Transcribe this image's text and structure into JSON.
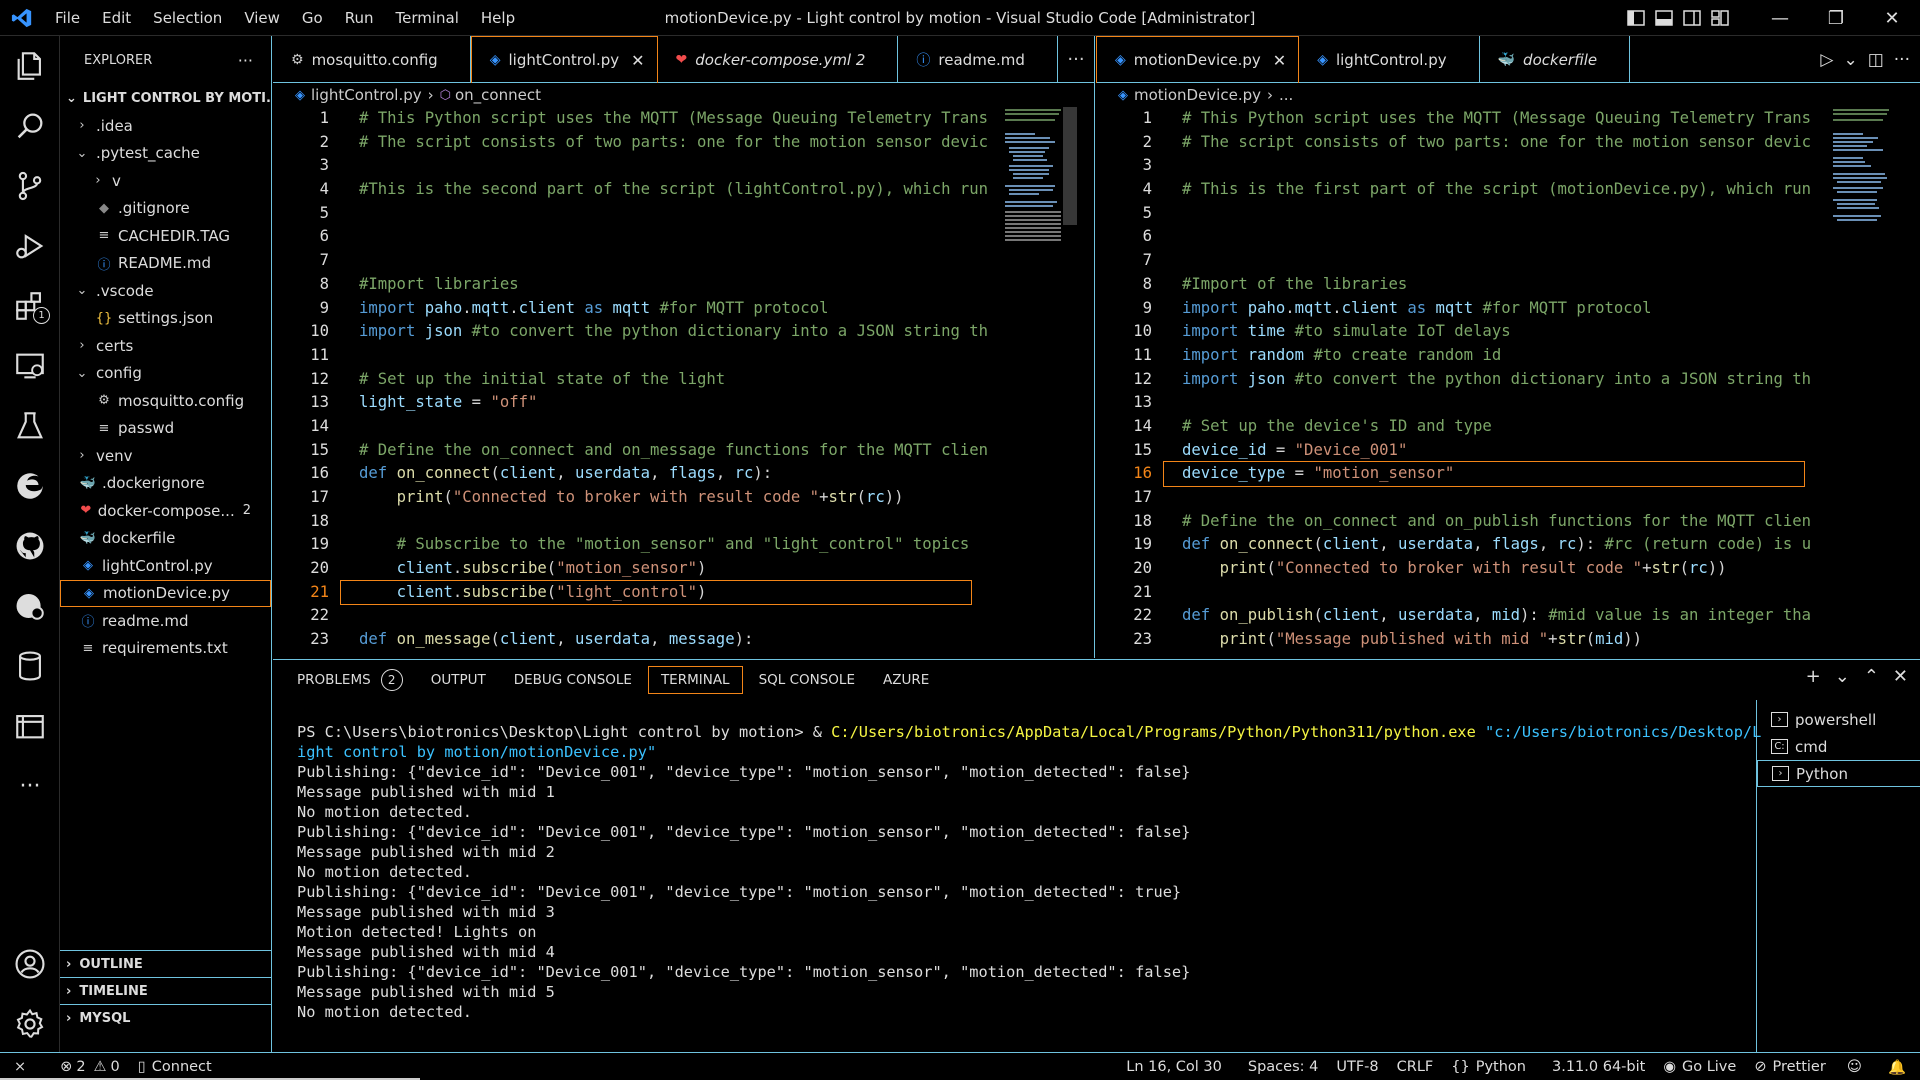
{
  "titlebar": {
    "menu": [
      "File",
      "Edit",
      "Selection",
      "View",
      "Go",
      "Run",
      "Terminal",
      "Help"
    ],
    "title": "motionDevice.py - Light control by motion - Visual Studio Code [Administrator]"
  },
  "sidebar": {
    "header": "EXPLORER",
    "folder": "LIGHT CONTROL BY MOTI...",
    "items": [
      {
        "label": ".idea",
        "chev": "›",
        "icon": "",
        "indent": 1
      },
      {
        "label": ".pytest_cache",
        "chev": "⌄",
        "icon": "",
        "indent": 1
      },
      {
        "label": "v",
        "chev": "›",
        "icon": "",
        "indent": 2
      },
      {
        "label": ".gitignore",
        "chev": "",
        "icon": "◆",
        "indent": 2
      },
      {
        "label": "CACHEDIR.TAG",
        "chev": "",
        "icon": "≡",
        "indent": 2
      },
      {
        "label": "README.md",
        "chev": "",
        "icon": "ⓘ",
        "indent": 2
      },
      {
        "label": ".vscode",
        "chev": "⌄",
        "icon": "",
        "indent": 1
      },
      {
        "label": "settings.json",
        "chev": "",
        "icon": "{}",
        "indent": 2
      },
      {
        "label": "certs",
        "chev": "›",
        "icon": "",
        "indent": 1
      },
      {
        "label": "config",
        "chev": "⌄",
        "icon": "",
        "indent": 1
      },
      {
        "label": "mosquitto.config",
        "chev": "",
        "icon": "⚙",
        "indent": 2
      },
      {
        "label": "passwd",
        "chev": "",
        "icon": "≡",
        "indent": 2
      },
      {
        "label": "venv",
        "chev": "›",
        "icon": "",
        "indent": 1
      },
      {
        "label": ".dockerignore",
        "chev": "",
        "icon": "🐳",
        "indent": 1
      },
      {
        "label": "docker-compose...",
        "chev": "",
        "icon": "❤",
        "indent": 1,
        "badge": "2"
      },
      {
        "label": "dockerfile",
        "chev": "",
        "icon": "🐳",
        "indent": 1
      },
      {
        "label": "lightControl.py",
        "chev": "",
        "icon": "◈",
        "indent": 1
      },
      {
        "label": "motionDevice.py",
        "chev": "",
        "icon": "◈",
        "indent": 1,
        "selected": true
      },
      {
        "label": "readme.md",
        "chev": "",
        "icon": "ⓘ",
        "indent": 1
      },
      {
        "label": "requirements.txt",
        "chev": "",
        "icon": "≡",
        "indent": 1
      }
    ],
    "sections": [
      "OUTLINE",
      "TIMELINE",
      "MYSQL"
    ],
    "more": "···"
  },
  "editor_left": {
    "tabs": [
      {
        "label": "mosquitto.config",
        "icon": "⚙",
        "italic": false
      },
      {
        "label": "lightControl.py",
        "icon": "◈",
        "italic": false,
        "active": true,
        "close": "✕"
      },
      {
        "label": "docker-compose.yml 2",
        "icon": "❤",
        "italic": true
      },
      {
        "label": "readme.md",
        "icon": "ⓘ",
        "italic": false
      }
    ],
    "more": "···",
    "breadcrumb": [
      "lightControl.py",
      "on_connect"
    ],
    "current_line": 21,
    "lines": [
      [
        [
          "c-com",
          "# This Python script uses the MQTT (Message Queuing Telemetry Trans"
        ]
      ],
      [
        [
          "c-com",
          "# The script consists of two parts: one for the motion sensor devic"
        ]
      ],
      [],
      [
        [
          "c-com",
          "#This is the second part of the script (lightControl.py), which run"
        ]
      ],
      [],
      [],
      [],
      [
        [
          "c-com",
          "#Import libraries"
        ]
      ],
      [
        [
          "c-kw",
          "import "
        ],
        [
          "c-var",
          "paho"
        ],
        [
          "c-txt",
          "."
        ],
        [
          "c-var",
          "mqtt"
        ],
        [
          "c-txt",
          "."
        ],
        [
          "c-var",
          "client"
        ],
        [
          "c-kw",
          " as "
        ],
        [
          "c-var",
          "mqtt"
        ],
        [
          "c-com",
          " #for MQTT protocol"
        ]
      ],
      [
        [
          "c-kw",
          "import "
        ],
        [
          "c-var",
          "json"
        ],
        [
          "c-com",
          " #to convert the python dictionary into a JSON string th"
        ]
      ],
      [],
      [
        [
          "c-com",
          "# Set up the initial state of the light"
        ]
      ],
      [
        [
          "c-var",
          "light_state"
        ],
        [
          "c-txt",
          " = "
        ],
        [
          "c-str",
          "\"off\""
        ]
      ],
      [],
      [
        [
          "c-com",
          "# Define the on_connect and on_message functions for the MQTT clien"
        ]
      ],
      [
        [
          "c-kw",
          "def "
        ],
        [
          "c-fn",
          "on_connect"
        ],
        [
          "c-txt",
          "("
        ],
        [
          "c-var",
          "client"
        ],
        [
          "c-txt",
          ", "
        ],
        [
          "c-var",
          "userdata"
        ],
        [
          "c-txt",
          ", "
        ],
        [
          "c-var",
          "flags"
        ],
        [
          "c-txt",
          ", "
        ],
        [
          "c-var",
          "rc"
        ],
        [
          "c-txt",
          "):"
        ]
      ],
      [
        [
          "c-txt",
          "    "
        ],
        [
          "c-fn",
          "print"
        ],
        [
          "c-txt",
          "("
        ],
        [
          "c-str",
          "\"Connected to broker with result code \""
        ],
        [
          "c-txt",
          "+"
        ],
        [
          "c-fn",
          "str"
        ],
        [
          "c-txt",
          "("
        ],
        [
          "c-var",
          "rc"
        ],
        [
          "c-txt",
          "))"
        ]
      ],
      [],
      [
        [
          "c-txt",
          "    "
        ],
        [
          "c-com",
          "# Subscribe to the \"motion_sensor\" and \"light_control\" topics"
        ]
      ],
      [
        [
          "c-txt",
          "    "
        ],
        [
          "c-var",
          "client"
        ],
        [
          "c-txt",
          "."
        ],
        [
          "c-fn",
          "subscribe"
        ],
        [
          "c-txt",
          "("
        ],
        [
          "c-str",
          "\"motion_sensor\""
        ],
        [
          "c-txt",
          ")"
        ]
      ],
      [
        [
          "c-txt",
          "    "
        ],
        [
          "c-var",
          "client"
        ],
        [
          "c-txt",
          "."
        ],
        [
          "c-fn",
          "subscribe"
        ],
        [
          "c-txt",
          "("
        ],
        [
          "c-str",
          "\"light_control\""
        ],
        [
          "c-txt",
          ")"
        ]
      ],
      [],
      [
        [
          "c-kw",
          "def "
        ],
        [
          "c-fn",
          "on_message"
        ],
        [
          "c-txt",
          "("
        ],
        [
          "c-var",
          "client"
        ],
        [
          "c-txt",
          ", "
        ],
        [
          "c-var",
          "userdata"
        ],
        [
          "c-txt",
          ", "
        ],
        [
          "c-var",
          "message"
        ],
        [
          "c-txt",
          "):"
        ]
      ]
    ]
  },
  "editor_right": {
    "tabs": [
      {
        "label": "motionDevice.py",
        "icon": "◈",
        "italic": false,
        "active": true,
        "close": "✕"
      },
      {
        "label": "lightControl.py",
        "icon": "◈",
        "italic": false
      },
      {
        "label": "dockerfile",
        "icon": "🐳",
        "italic": true
      }
    ],
    "actions": [
      "▷",
      "⌄",
      "◫",
      "···"
    ],
    "breadcrumb": [
      "motionDevice.py",
      "..."
    ],
    "current_line": 16,
    "lines": [
      [
        [
          "c-com",
          "# This Python script uses the MQTT (Message Queuing Telemetry Trans"
        ]
      ],
      [
        [
          "c-com",
          "# The script consists of two parts: one for the motion sensor devic"
        ]
      ],
      [],
      [
        [
          "c-com",
          "# This is the first part of the script (motionDevice.py), which run"
        ]
      ],
      [],
      [],
      [],
      [
        [
          "c-com",
          "#Import of the libraries"
        ]
      ],
      [
        [
          "c-kw",
          "import "
        ],
        [
          "c-var",
          "paho"
        ],
        [
          "c-txt",
          "."
        ],
        [
          "c-var",
          "mqtt"
        ],
        [
          "c-txt",
          "."
        ],
        [
          "c-var",
          "client"
        ],
        [
          "c-kw",
          " as "
        ],
        [
          "c-var",
          "mqtt"
        ],
        [
          "c-com",
          " #for MQTT protocol"
        ]
      ],
      [
        [
          "c-kw",
          "import "
        ],
        [
          "c-var",
          "time"
        ],
        [
          "c-com",
          " #to simulate IoT delays"
        ]
      ],
      [
        [
          "c-kw",
          "import "
        ],
        [
          "c-var",
          "random"
        ],
        [
          "c-com",
          " #to create random id"
        ]
      ],
      [
        [
          "c-kw",
          "import "
        ],
        [
          "c-var",
          "json"
        ],
        [
          "c-com",
          " #to convert the python dictionary into a JSON string th"
        ]
      ],
      [],
      [
        [
          "c-com",
          "# Set up the device's ID and type"
        ]
      ],
      [
        [
          "c-var",
          "device_id"
        ],
        [
          "c-txt",
          " = "
        ],
        [
          "c-str",
          "\"Device_001\""
        ]
      ],
      [
        [
          "c-var",
          "device_type"
        ],
        [
          "c-txt",
          " = "
        ],
        [
          "c-str",
          "\"motion_sensor\""
        ]
      ],
      [],
      [
        [
          "c-com",
          "# Define the on_connect and on_publish functions for the MQTT clien"
        ]
      ],
      [
        [
          "c-kw",
          "def "
        ],
        [
          "c-fn",
          "on_connect"
        ],
        [
          "c-txt",
          "("
        ],
        [
          "c-var",
          "client"
        ],
        [
          "c-txt",
          ", "
        ],
        [
          "c-var",
          "userdata"
        ],
        [
          "c-txt",
          ", "
        ],
        [
          "c-var",
          "flags"
        ],
        [
          "c-txt",
          ", "
        ],
        [
          "c-var",
          "rc"
        ],
        [
          "c-txt",
          "): "
        ],
        [
          "c-com",
          "#rc (return code) is u"
        ]
      ],
      [
        [
          "c-txt",
          "    "
        ],
        [
          "c-fn",
          "print"
        ],
        [
          "c-txt",
          "("
        ],
        [
          "c-str",
          "\"Connected to broker with result code \""
        ],
        [
          "c-txt",
          "+"
        ],
        [
          "c-fn",
          "str"
        ],
        [
          "c-txt",
          "("
        ],
        [
          "c-var",
          "rc"
        ],
        [
          "c-txt",
          "))"
        ]
      ],
      [],
      [
        [
          "c-kw",
          "def "
        ],
        [
          "c-fn",
          "on_publish"
        ],
        [
          "c-txt",
          "("
        ],
        [
          "c-var",
          "client"
        ],
        [
          "c-txt",
          ", "
        ],
        [
          "c-var",
          "userdata"
        ],
        [
          "c-txt",
          ", "
        ],
        [
          "c-var",
          "mid"
        ],
        [
          "c-txt",
          "): "
        ],
        [
          "c-com",
          "#mid value is an integer tha"
        ]
      ],
      [
        [
          "c-txt",
          "    "
        ],
        [
          "c-fn",
          "print"
        ],
        [
          "c-txt",
          "("
        ],
        [
          "c-str",
          "\"Message published with mid \""
        ],
        [
          "c-txt",
          "+"
        ],
        [
          "c-fn",
          "str"
        ],
        [
          "c-txt",
          "("
        ],
        [
          "c-var",
          "mid"
        ],
        [
          "c-txt",
          "))"
        ]
      ]
    ]
  },
  "panel": {
    "tabs": [
      {
        "label": "PROBLEMS",
        "badge": "2"
      },
      {
        "label": "OUTPUT"
      },
      {
        "label": "DEBUG CONSOLE"
      },
      {
        "label": "TERMINAL",
        "active": true
      },
      {
        "label": "SQL CONSOLE"
      },
      {
        "label": "AZURE"
      }
    ],
    "actions": [
      "+",
      "⌄",
      "⌃",
      "✕"
    ],
    "terminal": {
      "prompt": "PS C:\\Users\\biotronics\\Desktop\\Light control by motion> & ",
      "exe": "C:/Users/biotronics/AppData/Local/Programs/Python/Python311/python.exe",
      "arg1": " \"c:/Users/biotronics/Desktop/L",
      "arg2": "ight control by motion/motionDevice.py\"",
      "output": [
        "Publishing: {\"device_id\": \"Device_001\", \"device_type\": \"motion_sensor\", \"motion_detected\": false}",
        "Message published with mid 1",
        "No motion detected.",
        "Publishing: {\"device_id\": \"Device_001\", \"device_type\": \"motion_sensor\", \"motion_detected\": false}",
        "Message published with mid 2",
        "No motion detected.",
        "Publishing: {\"device_id\": \"Device_001\", \"device_type\": \"motion_sensor\", \"motion_detected\": true}",
        "Message published with mid 3",
        "Motion detected! Lights on",
        "Message published with mid 4",
        "Publishing: {\"device_id\": \"Device_001\", \"device_type\": \"motion_sensor\", \"motion_detected\": false}",
        "Message published with mid 5",
        "No motion detected."
      ]
    },
    "terminals": [
      {
        "label": "powershell",
        "icon": "›"
      },
      {
        "label": "cmd",
        "icon": "C:"
      },
      {
        "label": "Python",
        "icon": "›",
        "selected": true
      }
    ]
  },
  "statusbar": {
    "remote": "⨯",
    "errors": "2",
    "warnings": "0",
    "connect": "Connect",
    "position": "Ln 16, Col 30",
    "spaces": "Spaces: 4",
    "encoding": "UTF-8",
    "eol": "CRLF",
    "language": "Python",
    "interpreter": "3.11.0 64-bit",
    "golive": "Go Live",
    "prettier": "Prettier"
  },
  "colors": {
    "accent_border": "#6fc3df",
    "active_border": "#f38518",
    "vscode_blue": "#3794ff"
  }
}
